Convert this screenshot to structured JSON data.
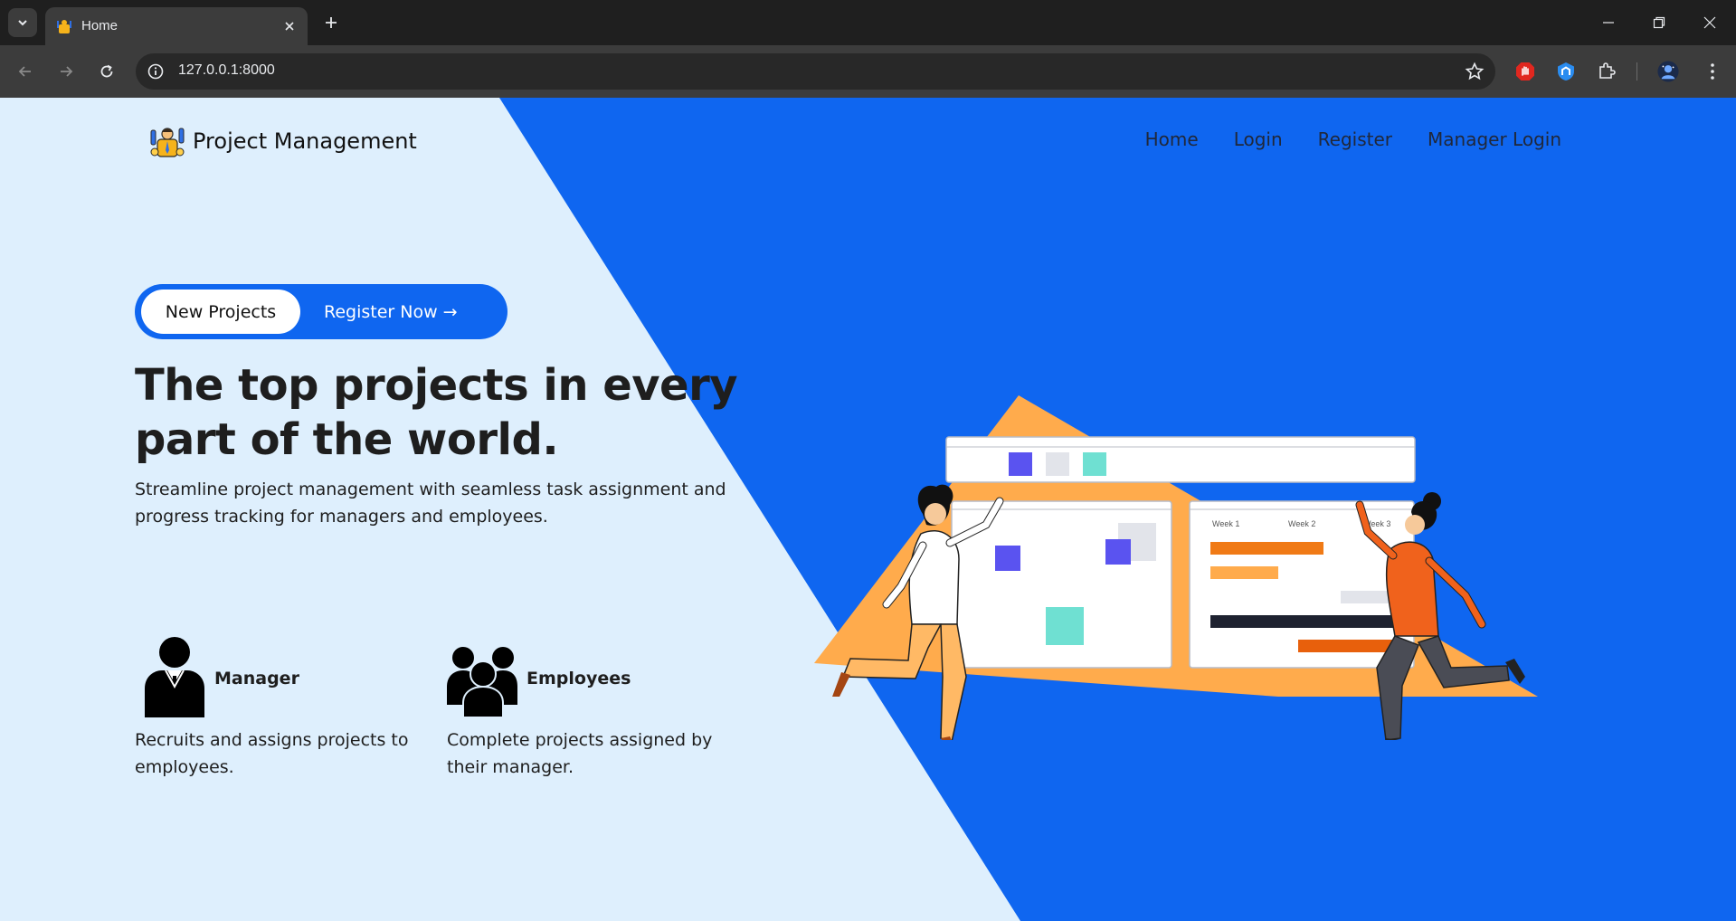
{
  "browser": {
    "tab_title": "Home",
    "url": "127.0.0.1:8000"
  },
  "site": {
    "brand": "Project Management",
    "nav": [
      "Home",
      "Login",
      "Register",
      "Manager Login"
    ]
  },
  "hero": {
    "badge_label": "New Projects",
    "cta_label": "Register Now →",
    "headline_line1": "The top projects in every",
    "headline_line2": "part of the world.",
    "lead": "Streamline project management with seamless task assignment and progress tracking for managers and employees."
  },
  "roles": [
    {
      "title": "Manager",
      "description": "Recruits and assigns projects to employees."
    },
    {
      "title": "Employees",
      "description": "Complete projects assigned by their manager."
    }
  ],
  "illustration": {
    "week_labels": [
      "Week 1",
      "Week 2",
      "Week 3"
    ]
  },
  "colors": {
    "page_bg": "#deeffd",
    "brand_blue": "#0f66f0",
    "accent_orange": "#ffab4c",
    "chrome_dark": "#1f1f1f",
    "chrome_mid": "#3c3c3c"
  }
}
